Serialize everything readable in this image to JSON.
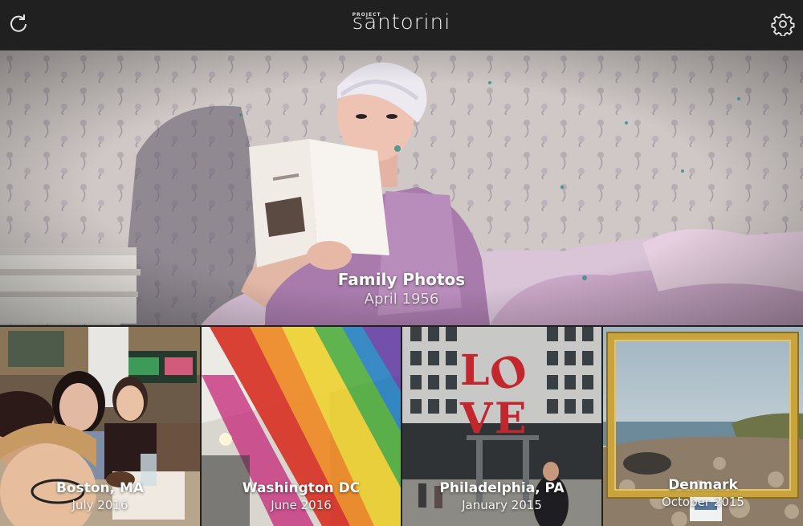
{
  "header": {
    "brand_prefix": "PROJECT",
    "brand_name": "santorini",
    "refresh_icon": "refresh-icon",
    "settings_icon": "gear-icon",
    "background": "#202020"
  },
  "albums": {
    "featured": {
      "title": "Family Photos",
      "date": "April 1956"
    },
    "items": [
      {
        "title": "Boston, MA",
        "date": "July 2016"
      },
      {
        "title": "Washington DC",
        "date": "June 2016"
      },
      {
        "title": "Philadelphia, PA",
        "date": "January 2015"
      },
      {
        "title": "Denmark",
        "date": "October 2015"
      }
    ]
  },
  "photo_art": {
    "love_sculpture_letters": "LOVE"
  }
}
